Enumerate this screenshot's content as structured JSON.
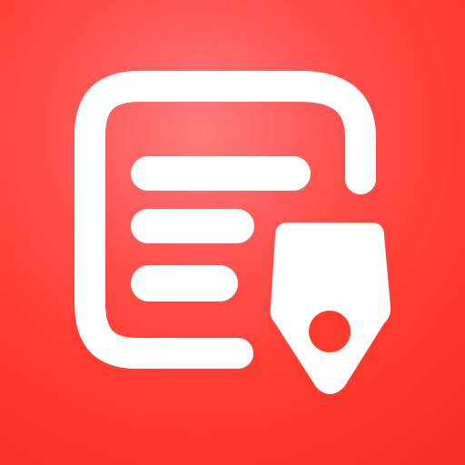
{
  "icon": {
    "name": "notes-pen-app-icon",
    "colors": {
      "background_top_left": "#ff6e6e",
      "background_bottom_right": "#f52d24",
      "foreground": "#ffffff",
      "accent_dot": "#ff3b30"
    },
    "glyphs": [
      "document-icon",
      "text-lines-icon",
      "pen-nib-icon"
    ]
  }
}
